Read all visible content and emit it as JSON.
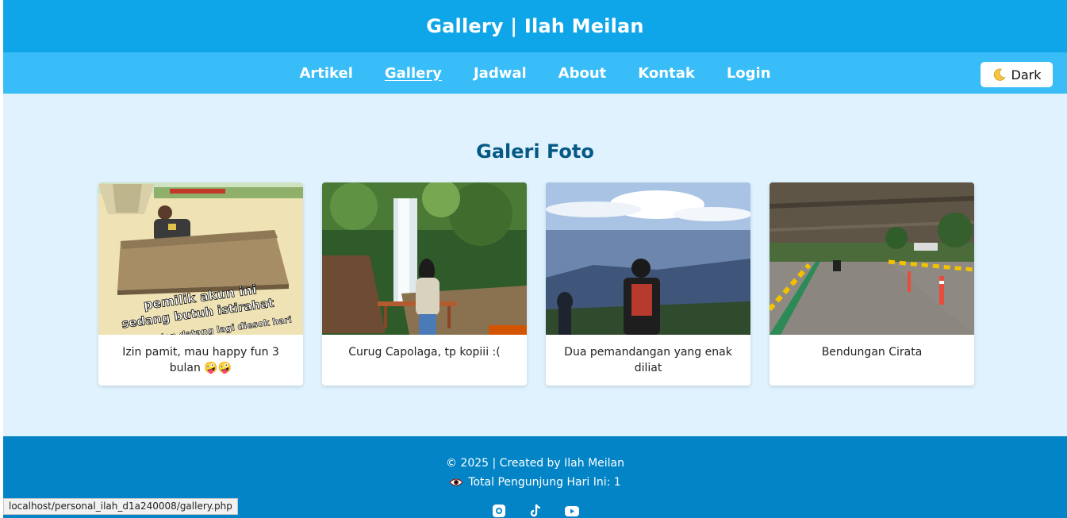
{
  "header": {
    "title": "Gallery | Ilah Meilan"
  },
  "nav": {
    "items": [
      {
        "label": "Artikel",
        "active": false
      },
      {
        "label": "Gallery",
        "active": true
      },
      {
        "label": "Jadwal",
        "active": false
      },
      {
        "label": "About",
        "active": false
      },
      {
        "label": "Kontak",
        "active": false
      },
      {
        "label": "Login",
        "active": false
      }
    ],
    "theme_toggle": {
      "label": "Dark",
      "icon": "moon-icon"
    }
  },
  "main": {
    "title": "Galeri Foto",
    "photos": [
      {
        "caption": "Izin pamit, mau happy fun 3 bulan 🤪🤪",
        "image": "meme-table-photo",
        "overlay_lines": [
          "pemilik akun ini",
          "sedang butuh istirahat",
          "dan datang lagi diesok hari"
        ]
      },
      {
        "caption": "Curug Capolaga, tp kopiii :(",
        "image": "waterfall-photo"
      },
      {
        "caption": "Dua pemandangan yang enak diliat",
        "image": "mountain-view-photo"
      },
      {
        "caption": "Bendungan Cirata",
        "image": "dam-road-photo"
      }
    ]
  },
  "footer": {
    "copyright": "© 2025 | Created by Ilah Meilan",
    "visitors": "Total Pengunjung Hari Ini: 1",
    "visitors_icon": "eye-icon",
    "social_icons": [
      "instagram-icon",
      "tiktok-icon",
      "youtube-icon"
    ]
  },
  "status_bar": {
    "url": "localhost/personal_ilah_d1a240008/gallery.php"
  },
  "colors": {
    "header_bg": "#0ea5e9",
    "nav_bg": "#38bdf8",
    "page_bg": "#e0f2fe",
    "footer_bg": "#0284c7",
    "title_color": "#075985"
  }
}
